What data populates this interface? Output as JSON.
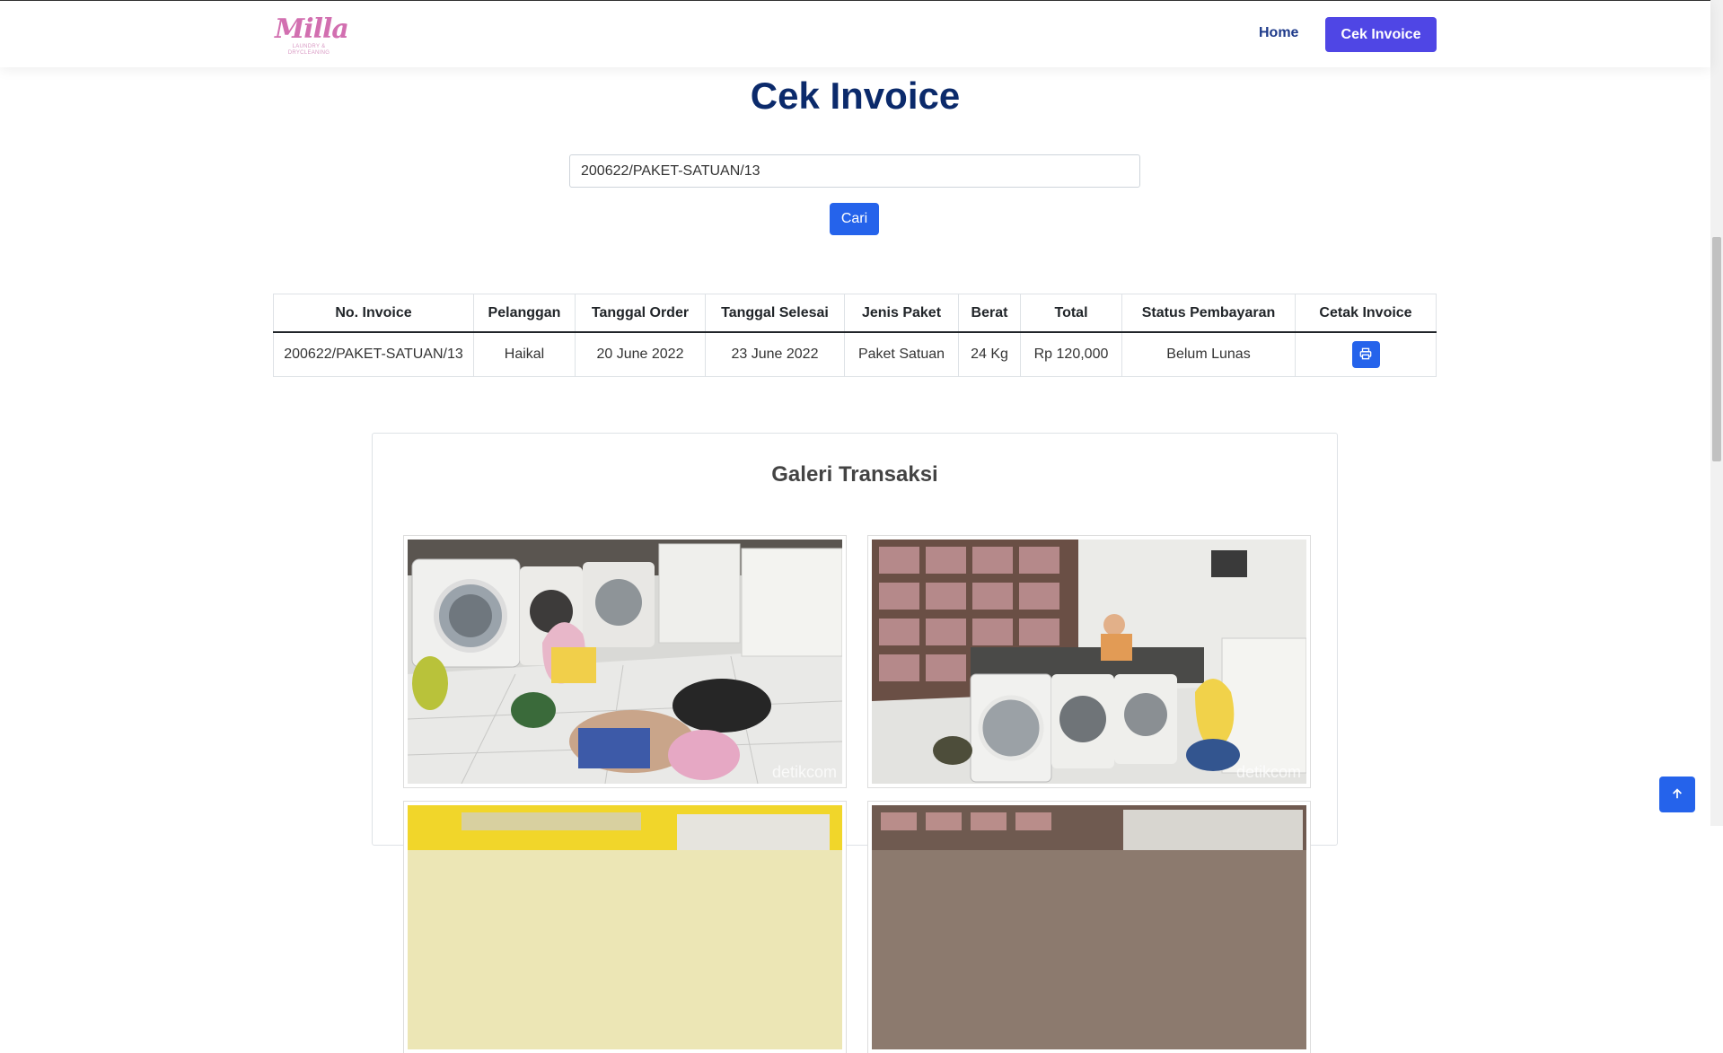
{
  "brand": {
    "logo_text": "Milla",
    "logo_subtitle": "LAUNDRY & DRYCLEANING"
  },
  "nav": {
    "home_label": "Home",
    "cek_invoice_label": "Cek Invoice"
  },
  "page": {
    "title": "Cek Invoice"
  },
  "search": {
    "value": "200622/PAKET-SATUAN/13",
    "button_label": "Cari"
  },
  "table": {
    "headers": {
      "invoice": "No. Invoice",
      "customer": "Pelanggan",
      "order_date": "Tanggal Order",
      "finish_date": "Tanggal Selesai",
      "package": "Jenis Paket",
      "weight": "Berat",
      "total": "Total",
      "payment_status": "Status Pembayaran",
      "print": "Cetak Invoice"
    },
    "rows": [
      {
        "invoice": "200622/PAKET-SATUAN/13",
        "customer": "Haikal",
        "order_date": "20 June 2022",
        "finish_date": "23 June 2022",
        "package": "Paket Satuan",
        "weight": "24 Kg",
        "total": "Rp 120,000",
        "payment_status": "Belum Lunas"
      }
    ]
  },
  "gallery": {
    "title": "Galeri Transaksi",
    "watermark": "detikcom"
  },
  "colors": {
    "primary": "#2563eb",
    "nav_button": "#4f46e5",
    "title": "#0b2a6b",
    "brand_pink": "#d26fb0"
  },
  "icons": {
    "print": "printer-icon",
    "back_to_top": "arrow-up-icon"
  }
}
